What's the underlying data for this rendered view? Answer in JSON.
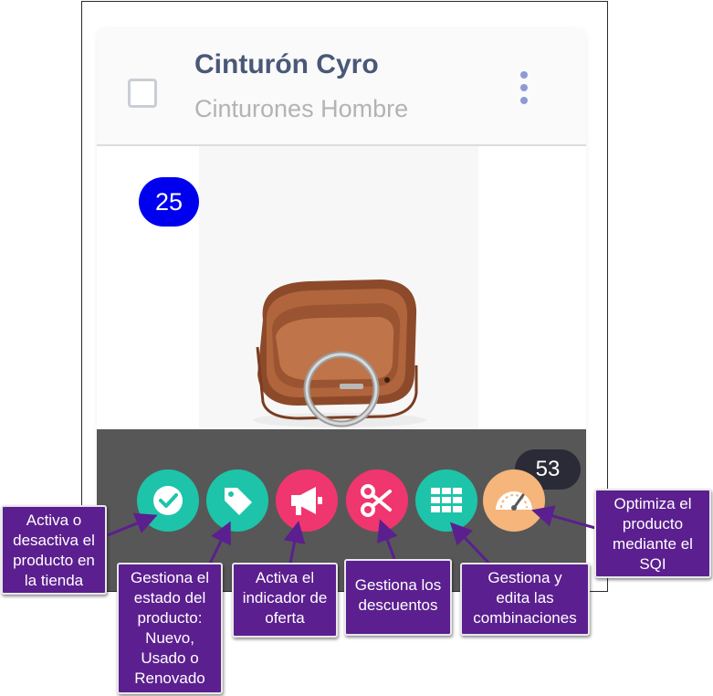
{
  "product": {
    "name": "Cinturón Cyro",
    "category": "Cinturones Hombre",
    "image_badge": "25",
    "sqi_score": "53"
  },
  "actions": [
    {
      "icon": "check-circle-icon",
      "color": "#1ec4a9"
    },
    {
      "icon": "tag-icon",
      "color": "#1ec4a9"
    },
    {
      "icon": "megaphone-icon",
      "color": "#f0366f"
    },
    {
      "icon": "scissors-icon",
      "color": "#f0366f"
    },
    {
      "icon": "grid-icon",
      "color": "#1ec4a9"
    },
    {
      "icon": "speedometer-icon",
      "color": "#f5b57b"
    }
  ],
  "callouts": {
    "toggle": [
      "Activa o",
      "desactiva el",
      "producto en",
      "la tienda"
    ],
    "state": [
      "Gestiona el",
      "estado del",
      "producto:",
      "Nuevo,",
      "Usado o",
      "Renovado"
    ],
    "offer": [
      "Activa el",
      "indicador de",
      "oferta"
    ],
    "discounts": [
      "Gestiona los",
      "descuentos"
    ],
    "combinations": [
      "Gestiona y",
      "edita las",
      "combinaciones"
    ],
    "sqi": [
      "Optimiza el",
      "producto",
      "mediante el",
      "SQI"
    ]
  },
  "colors": {
    "title": "#4a5878",
    "subtitle": "#b3b3b3",
    "badge": "#0000ee",
    "action_bar": "#575757",
    "callout": "#5b1f8f"
  }
}
